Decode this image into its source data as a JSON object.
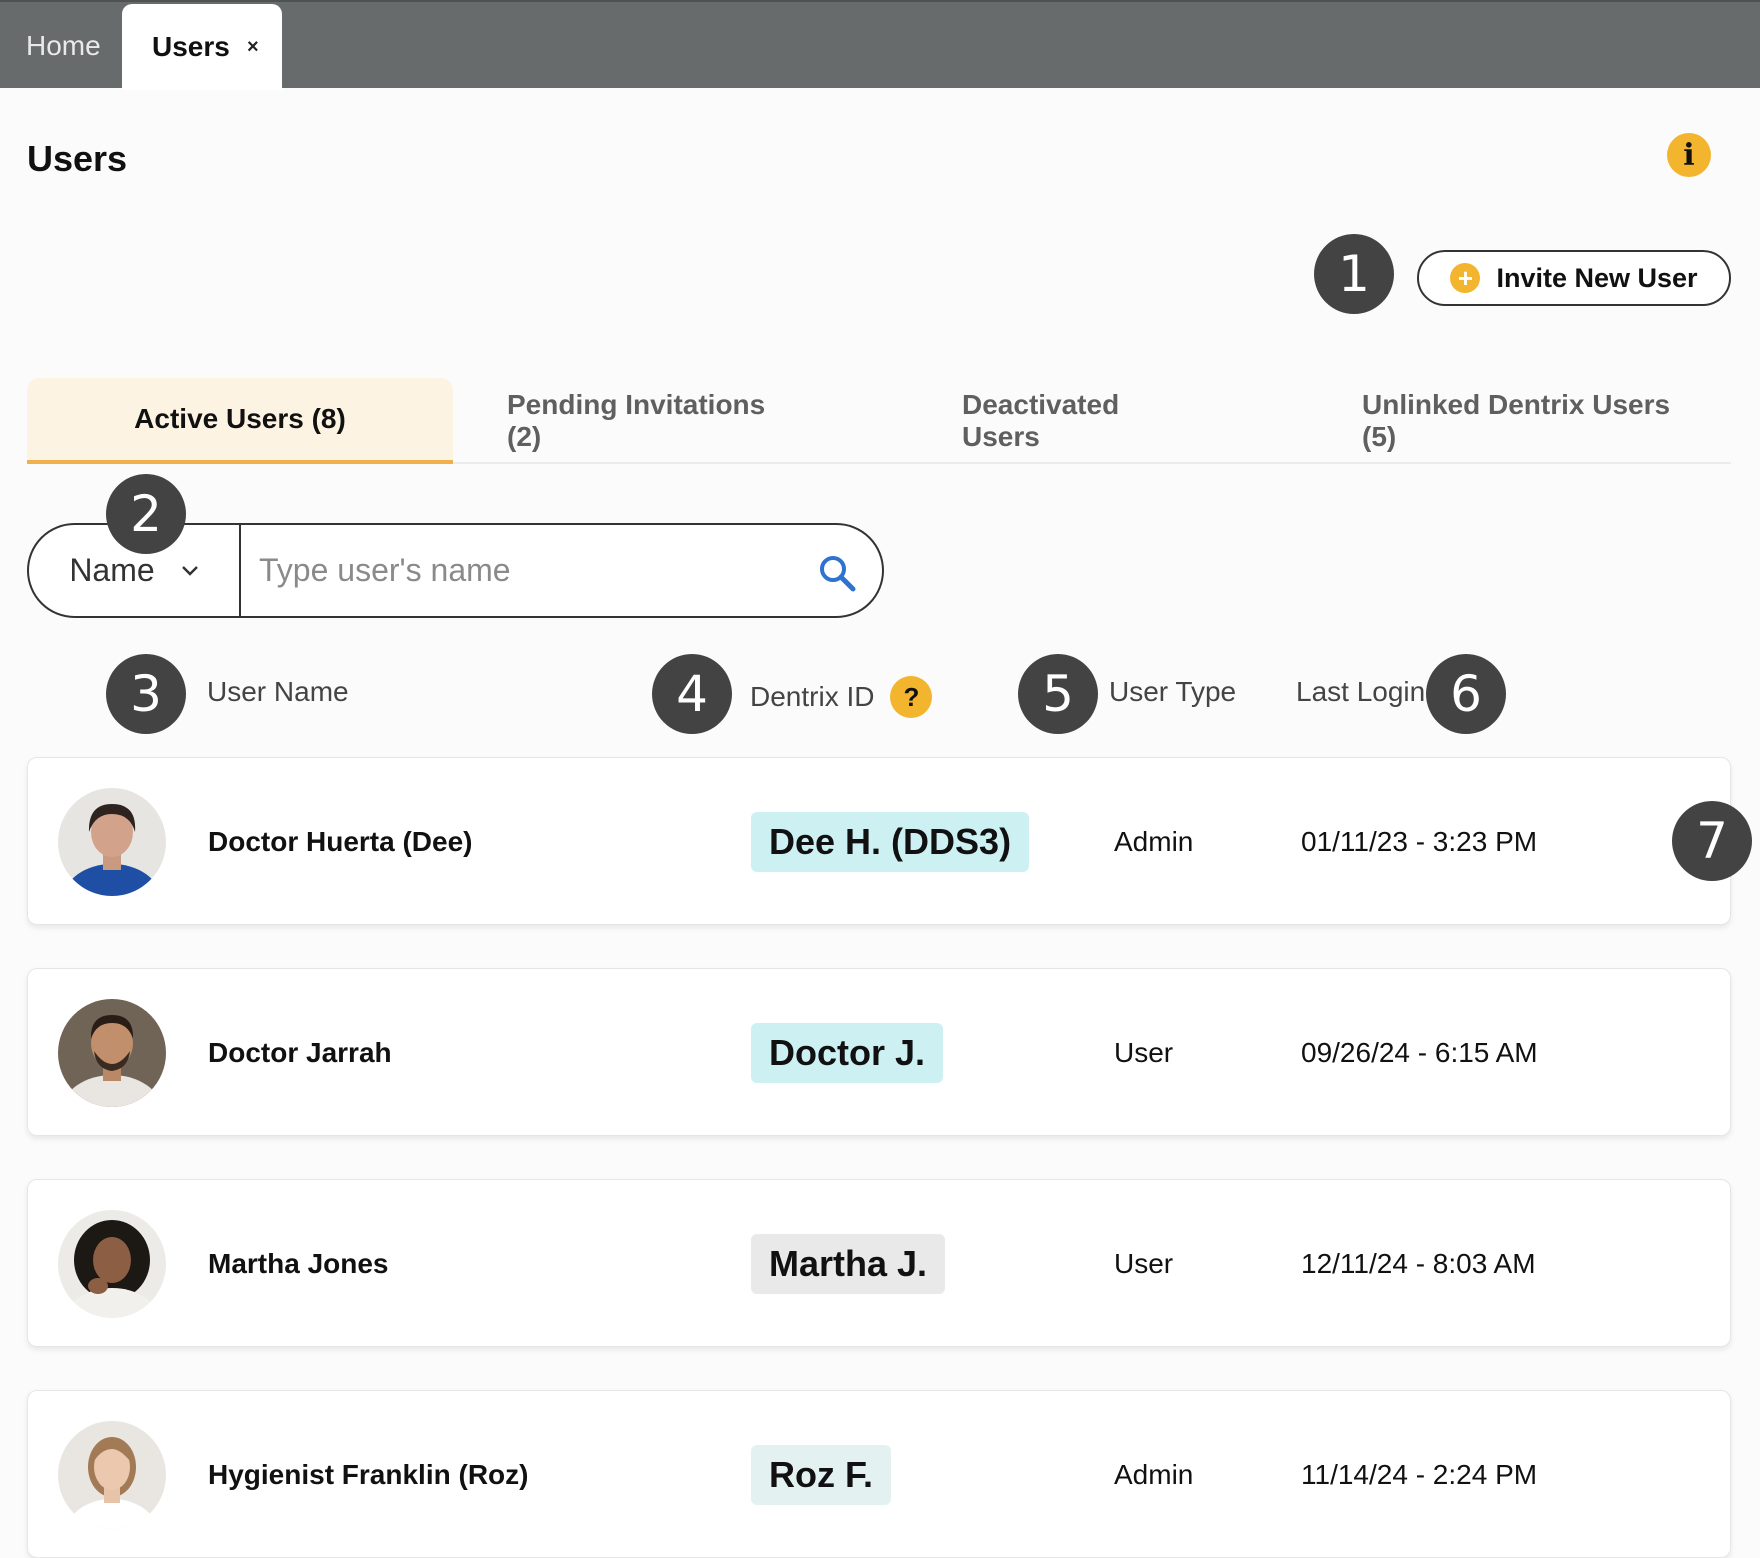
{
  "tabs": [
    {
      "label": "Home"
    },
    {
      "label": "Users",
      "close": "×"
    }
  ],
  "page": {
    "title": "Users",
    "info_icon": "i"
  },
  "markers": [
    "1",
    "2",
    "3",
    "4",
    "5",
    "6",
    "7"
  ],
  "invite_button": {
    "label": "Invite New User",
    "icon": "+"
  },
  "subtabs": [
    {
      "label": "Active Users (8)"
    },
    {
      "label": "Pending Invitations (2)"
    },
    {
      "label": "Deactivated Users"
    },
    {
      "label": "Unlinked Dentrix Users (5)"
    }
  ],
  "search": {
    "field": "Name",
    "placeholder": "Type user's name"
  },
  "columns": {
    "user_name": "User Name",
    "dentrix_id": "Dentrix ID",
    "help": "?",
    "user_type": "User Type",
    "last_login": "Last Login"
  },
  "users": [
    {
      "name": "Doctor Huerta (Dee)",
      "dentrix_id": "Dee H. (DDS3)",
      "type": "Admin",
      "last_login": "01/11/23 - 3:23 PM",
      "chip_color": "#cdf1f3"
    },
    {
      "name": "Doctor Jarrah",
      "dentrix_id": "Doctor J.",
      "type": "User",
      "last_login": "09/26/24 - 6:15 AM",
      "chip_color": "#cdf1f3"
    },
    {
      "name": "Martha Jones",
      "dentrix_id": "Martha J.",
      "type": "User",
      "last_login": "12/11/24 - 8:03 AM",
      "chip_color": "#e9e9e9"
    },
    {
      "name": "Hygienist Franklin (Roz)",
      "dentrix_id": "Roz F.",
      "type": "Admin",
      "last_login": "11/14/24 - 2:24 PM",
      "chip_color": "#e4f1f1"
    }
  ],
  "colors": {
    "accent": "#f2b52d",
    "marker": "#434343",
    "topbar": "#676b6b"
  }
}
